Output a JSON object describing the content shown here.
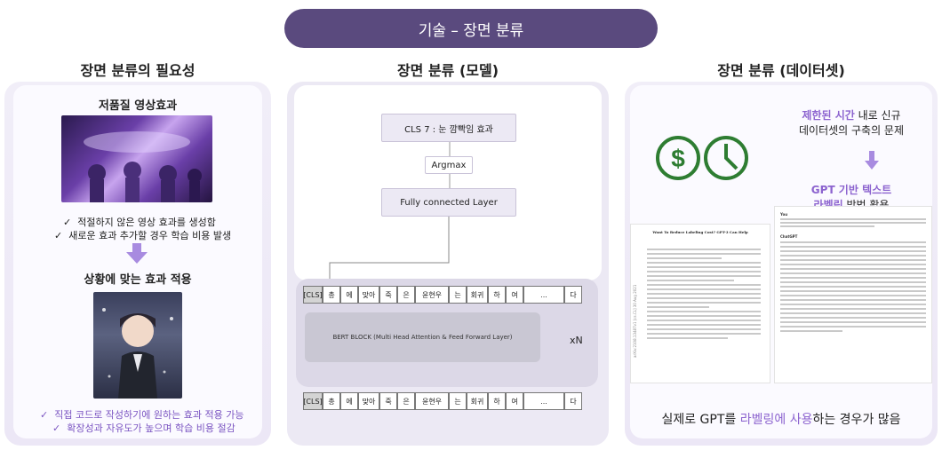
{
  "header": {
    "title": "기술 – 장면 분류"
  },
  "columns": [
    {
      "title": "장면 분류의 필요성"
    },
    {
      "title": "장면 분류 (모델)"
    },
    {
      "title": "장면 분류 (데이터셋)"
    }
  ],
  "need": {
    "top_heading": "저품질 영상효과",
    "problems": [
      "적절하지 않은 영상 효과를 생성함",
      "새로운 효과 추가할 경우 학습 비용 발생"
    ],
    "bottom_heading": "상황에 맞는 효과 적용",
    "benefits": [
      "직접 코드로 작성하기에 원하는 효과 적용 가능",
      "확장성과 자유도가 높으며  학습 비용 절감"
    ],
    "check_glyph": "✓"
  },
  "model": {
    "output_label": "CLS 7 : 눈 깜빡임 효과",
    "argmax_label": "Argmax",
    "fc_label": "Fully connected Layer",
    "bert_label": "BERT BLOCK (Multi Head Attention & Feed Forward Layer)",
    "repeat_label": "xN",
    "tokens": [
      "[CLS]",
      "총",
      "에",
      "맞아",
      "죽",
      "은",
      "윤현우",
      "는",
      "회귀",
      "하",
      "여",
      "...",
      "다"
    ]
  },
  "dataset": {
    "problem_highlight": "제한된 시간",
    "problem_rest": " 내로 신규",
    "problem_line2": "데이터셋의 구축의 문제",
    "solution_highlight_1": "GPT 기반 텍스트",
    "solution_highlight_2": "라벨링",
    "solution_rest": " 방법 활용",
    "paper_title": "Want To Reduce Labeling Cost? GPT-3 Can Help",
    "paper_side": "arXiv:2108.13487v1 [cs.CL] 30 Aug 2021",
    "chat_you": "You",
    "chat_gpt": "ChatGPT",
    "bottom_prefix": "실제로 GPT를 ",
    "bottom_highlight": "라벨링에 사용",
    "bottom_suffix": "하는 경우가 많음"
  },
  "colors": {
    "accent": "#8c63cf",
    "header_bg": "#5a4a7e",
    "icon_green": "#2e7d32"
  }
}
